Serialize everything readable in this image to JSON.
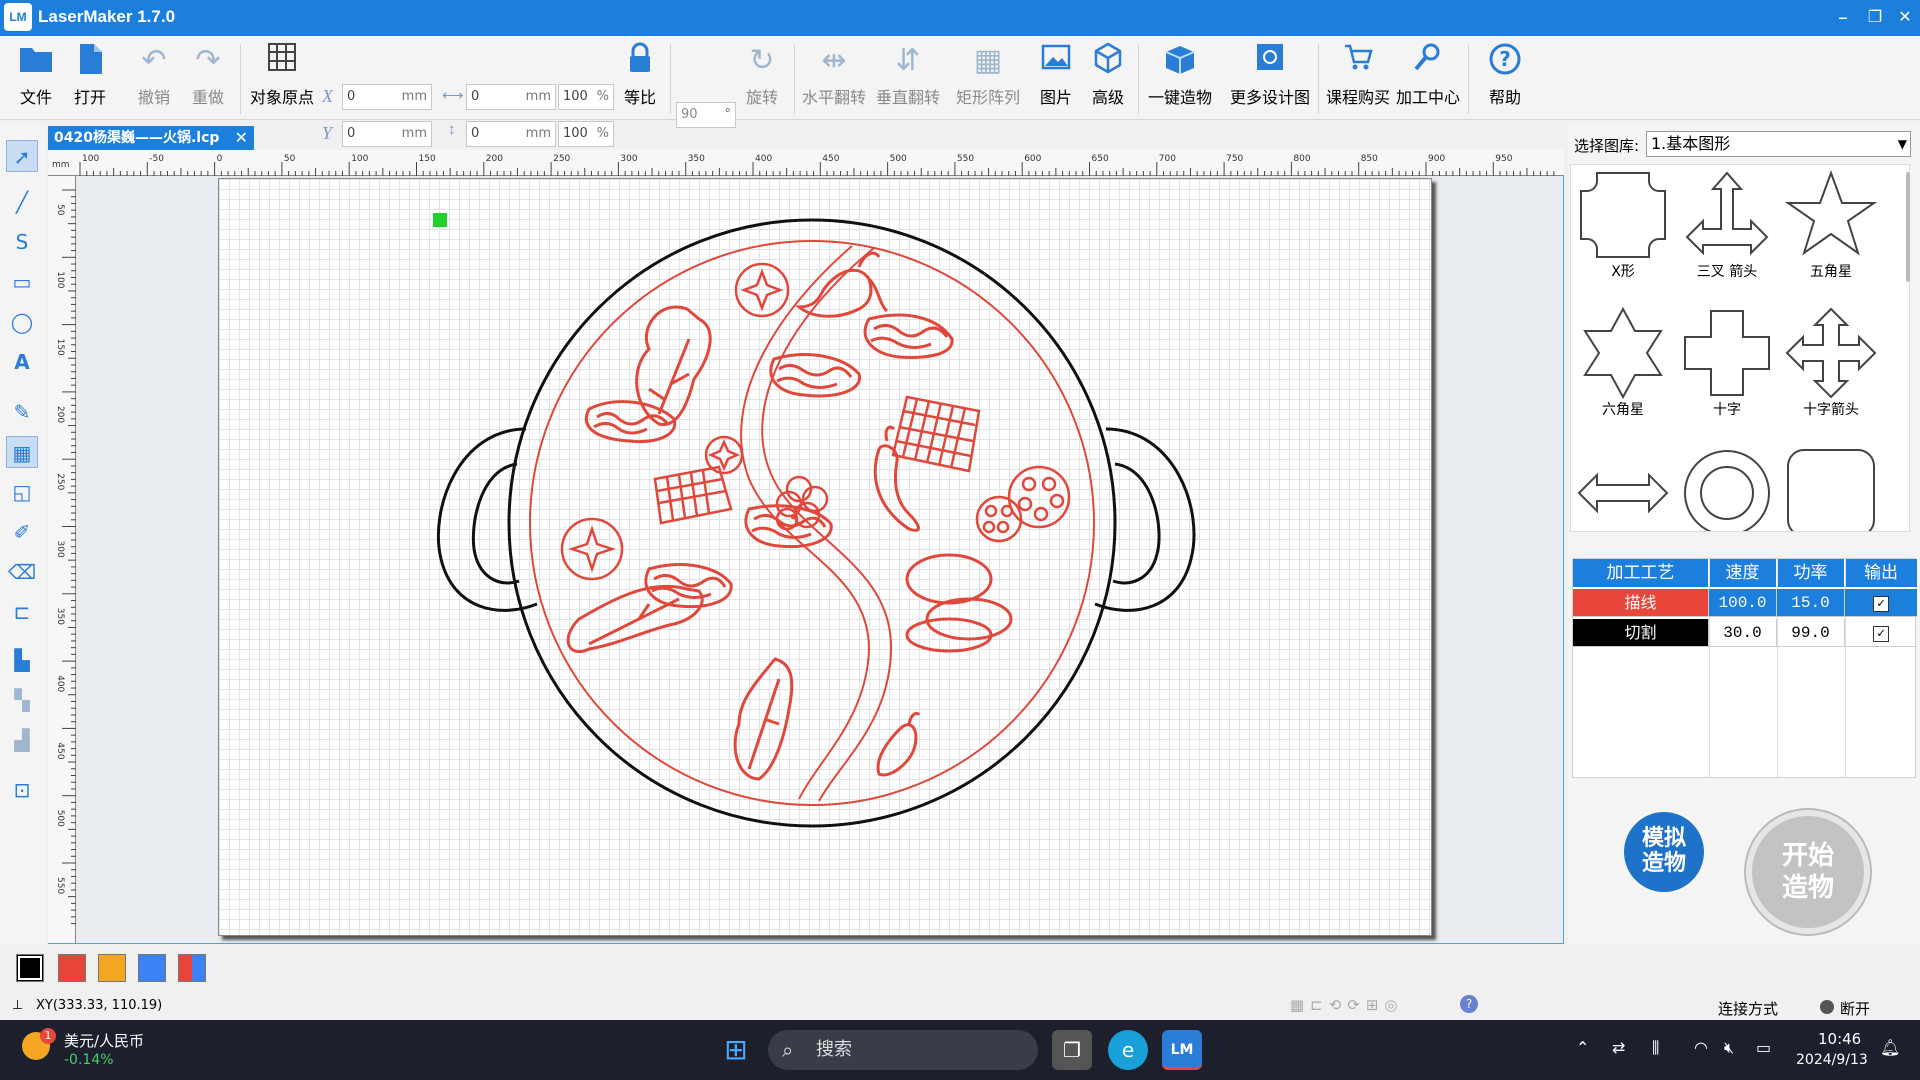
{
  "app": {
    "title": "LaserMaker 1.7.0",
    "logo": "LM"
  },
  "window_controls": {
    "minimize": "–",
    "restore": "❐",
    "close": "✕"
  },
  "toolbar": {
    "file": "文件",
    "open": "打开",
    "undo": "撤销",
    "redo": "重做",
    "origin": "对象原点",
    "x_label": "X",
    "y_label": "Y",
    "x_value": "0",
    "y_value": "0",
    "unit": "mm",
    "w_value": "0",
    "h_value": "0",
    "w_pct": "100",
    "h_pct": "100",
    "pct": "%",
    "ratio": "等比",
    "rotate_value": "90",
    "rotate_deg": "°",
    "rotate": "旋转",
    "flip_h": "水平翻转",
    "flip_v": "垂直翻转",
    "array": "矩形阵列",
    "image": "图片",
    "advanced": "高级",
    "one_click": "一键造物",
    "more_designs": "更多设计图",
    "course": "课程购买",
    "process_center": "加工中心",
    "help": "帮助"
  },
  "document": {
    "tab": "0420杨渠巍——火锅.lcp",
    "close": "✕",
    "corner": "mm"
  },
  "ruler": {
    "h_ticks": [
      "100",
      "-50",
      "0",
      "50",
      "100",
      "150",
      "200",
      "250",
      "300",
      "350",
      "400",
      "450",
      "500",
      "550",
      "600",
      "650",
      "700",
      "750",
      "800",
      "850",
      "900",
      "950"
    ],
    "v_ticks": [
      "50",
      "100",
      "150",
      "200",
      "250",
      "300",
      "350",
      "400",
      "450",
      "500",
      "550"
    ]
  },
  "library": {
    "label": "选择图库:",
    "selected": "1.基本图形",
    "shapes": [
      "X形",
      "三叉 箭头",
      "五角星",
      "六角星",
      "十字",
      "十字箭头",
      "",
      "",
      ""
    ]
  },
  "process": {
    "headers": [
      "加工工艺",
      "速度",
      "功率",
      "输出"
    ],
    "rows": [
      {
        "name": "描线",
        "speed": "100.0",
        "power": "15.0",
        "output": "✓",
        "color": "#e8463a"
      },
      {
        "name": "切割",
        "speed": "30.0",
        "power": "99.0",
        "output": "✓",
        "color": "#000000"
      }
    ]
  },
  "buttons": {
    "simulate": "模拟\n造物",
    "simulate_l1": "模拟",
    "simulate_l2": "造物",
    "start_l1": "开始",
    "start_l2": "造物"
  },
  "palette": [
    "#000000",
    "#e8463a",
    "#f5a623",
    "#3b82f6",
    "multi"
  ],
  "status": {
    "coords": "XY(333.33, 110.19)",
    "connection_label": "连接方式",
    "connection_state": "断开"
  },
  "taskbar": {
    "widget_title": "美元/人民币",
    "widget_change": "-0.14%",
    "widget_badge": "1",
    "search": "搜索",
    "time": "10:46",
    "date": "2024/9/13"
  }
}
